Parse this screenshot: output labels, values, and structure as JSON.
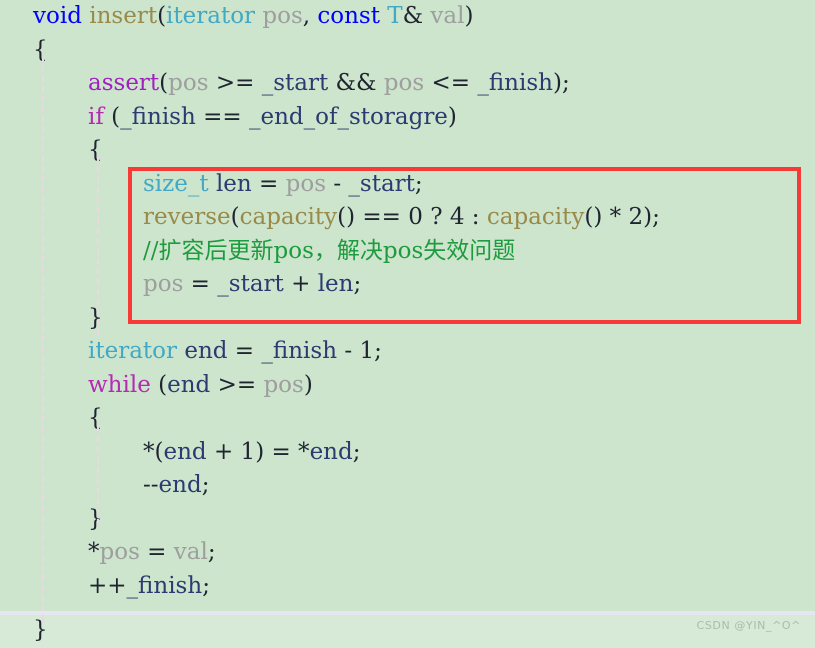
{
  "editor": {
    "background_color": "#cce5cc",
    "highlight_box_color": "#f73a35",
    "last_line_background": "#d7e9d7"
  },
  "watermark": {
    "text": "CSDN @YIN_^O^"
  },
  "code": {
    "language": "C++",
    "lines": [
      {
        "indent": 0,
        "tokens": [
          {
            "t": "void",
            "c": "k-blue"
          },
          {
            "t": " ",
            "c": "k-plain"
          },
          {
            "t": "insert",
            "c": "k-olive"
          },
          {
            "t": "(",
            "c": "k-plain"
          },
          {
            "t": "iterator",
            "c": "k-teal"
          },
          {
            "t": " ",
            "c": "k-plain"
          },
          {
            "t": "pos",
            "c": "k-gray"
          },
          {
            "t": ", ",
            "c": "k-plain"
          },
          {
            "t": "const",
            "c": "k-blue"
          },
          {
            "t": " ",
            "c": "k-plain"
          },
          {
            "t": "T",
            "c": "k-teal"
          },
          {
            "t": "& ",
            "c": "k-plain"
          },
          {
            "t": "val",
            "c": "k-gray"
          },
          {
            "t": ")",
            "c": "k-plain"
          }
        ]
      },
      {
        "indent": 0,
        "tokens": [
          {
            "t": "{",
            "c": "k-plain"
          }
        ]
      },
      {
        "indent": 1,
        "tokens": [
          {
            "t": "assert",
            "c": "k-purple"
          },
          {
            "t": "(",
            "c": "k-plain"
          },
          {
            "t": "pos",
            "c": "k-gray"
          },
          {
            "t": " >= ",
            "c": "k-plain"
          },
          {
            "t": "_start",
            "c": "k-navy"
          },
          {
            "t": " && ",
            "c": "k-plain"
          },
          {
            "t": "pos",
            "c": "k-gray"
          },
          {
            "t": " <= ",
            "c": "k-plain"
          },
          {
            "t": "_finish",
            "c": "k-navy"
          },
          {
            "t": ");",
            "c": "k-plain"
          }
        ]
      },
      {
        "indent": 1,
        "tokens": [
          {
            "t": "if",
            "c": "k-magenta"
          },
          {
            "t": " (",
            "c": "k-plain"
          },
          {
            "t": "_finish",
            "c": "k-navy"
          },
          {
            "t": " == ",
            "c": "k-plain"
          },
          {
            "t": "_end_of_storagre",
            "c": "k-navy"
          },
          {
            "t": ")",
            "c": "k-plain"
          }
        ]
      },
      {
        "indent": 1,
        "tokens": [
          {
            "t": "{",
            "c": "k-plain"
          }
        ]
      },
      {
        "indent": 2,
        "tokens": [
          {
            "t": "size_t",
            "c": "k-teal"
          },
          {
            "t": " ",
            "c": "k-plain"
          },
          {
            "t": "len",
            "c": "k-navy"
          },
          {
            "t": " = ",
            "c": "k-plain"
          },
          {
            "t": "pos",
            "c": "k-gray"
          },
          {
            "t": " - ",
            "c": "k-plain"
          },
          {
            "t": "_start",
            "c": "k-navy"
          },
          {
            "t": ";",
            "c": "k-plain"
          }
        ]
      },
      {
        "indent": 2,
        "tokens": [
          {
            "t": "reverse",
            "c": "k-olive"
          },
          {
            "t": "(",
            "c": "k-plain"
          },
          {
            "t": "capacity",
            "c": "k-olive"
          },
          {
            "t": "() == ",
            "c": "k-plain"
          },
          {
            "t": "0",
            "c": "k-num"
          },
          {
            "t": " ? ",
            "c": "k-plain"
          },
          {
            "t": "4",
            "c": "k-num"
          },
          {
            "t": " : ",
            "c": "k-plain"
          },
          {
            "t": "capacity",
            "c": "k-olive"
          },
          {
            "t": "() * ",
            "c": "k-plain"
          },
          {
            "t": "2",
            "c": "k-num"
          },
          {
            "t": ");",
            "c": "k-plain"
          }
        ]
      },
      {
        "indent": 2,
        "tokens": [
          {
            "t": "//扩容后更新pos，解决pos失效问题",
            "c": "k-green"
          }
        ]
      },
      {
        "indent": 2,
        "tokens": [
          {
            "t": "pos",
            "c": "k-gray"
          },
          {
            "t": " = ",
            "c": "k-plain"
          },
          {
            "t": "_start",
            "c": "k-navy"
          },
          {
            "t": " + ",
            "c": "k-plain"
          },
          {
            "t": "len",
            "c": "k-navy"
          },
          {
            "t": ";",
            "c": "k-plain"
          }
        ]
      },
      {
        "indent": 1,
        "tokens": [
          {
            "t": "}",
            "c": "k-plain"
          }
        ]
      },
      {
        "indent": 1,
        "tokens": [
          {
            "t": "iterator",
            "c": "k-teal"
          },
          {
            "t": " ",
            "c": "k-plain"
          },
          {
            "t": "end",
            "c": "k-navy"
          },
          {
            "t": " = ",
            "c": "k-plain"
          },
          {
            "t": "_finish",
            "c": "k-navy"
          },
          {
            "t": " - ",
            "c": "k-plain"
          },
          {
            "t": "1",
            "c": "k-num"
          },
          {
            "t": ";",
            "c": "k-plain"
          }
        ]
      },
      {
        "indent": 1,
        "tokens": [
          {
            "t": "while",
            "c": "k-magenta"
          },
          {
            "t": " (",
            "c": "k-plain"
          },
          {
            "t": "end",
            "c": "k-navy"
          },
          {
            "t": " >= ",
            "c": "k-plain"
          },
          {
            "t": "pos",
            "c": "k-gray"
          },
          {
            "t": ")",
            "c": "k-plain"
          }
        ]
      },
      {
        "indent": 1,
        "tokens": [
          {
            "t": "{",
            "c": "k-plain"
          }
        ]
      },
      {
        "indent": 2,
        "tokens": [
          {
            "t": "*(",
            "c": "k-plain"
          },
          {
            "t": "end",
            "c": "k-navy"
          },
          {
            "t": " + ",
            "c": "k-plain"
          },
          {
            "t": "1",
            "c": "k-num"
          },
          {
            "t": ") = *",
            "c": "k-plain"
          },
          {
            "t": "end",
            "c": "k-navy"
          },
          {
            "t": ";",
            "c": "k-plain"
          }
        ]
      },
      {
        "indent": 2,
        "tokens": [
          {
            "t": "--",
            "c": "k-plain"
          },
          {
            "t": "end",
            "c": "k-navy"
          },
          {
            "t": ";",
            "c": "k-plain"
          }
        ]
      },
      {
        "indent": 1,
        "tokens": [
          {
            "t": "}",
            "c": "k-plain"
          }
        ]
      },
      {
        "indent": 1,
        "tokens": [
          {
            "t": "*",
            "c": "k-plain"
          },
          {
            "t": "pos",
            "c": "k-gray"
          },
          {
            "t": " = ",
            "c": "k-plain"
          },
          {
            "t": "val",
            "c": "k-gray"
          },
          {
            "t": ";",
            "c": "k-plain"
          }
        ]
      },
      {
        "indent": 1,
        "tokens": [
          {
            "t": "++",
            "c": "k-plain"
          },
          {
            "t": "_finish",
            "c": "k-navy"
          },
          {
            "t": ";",
            "c": "k-plain"
          }
        ]
      }
    ],
    "last_line": {
      "indent": 0,
      "tokens": [
        {
          "t": "}",
          "c": "k-plain"
        }
      ]
    }
  }
}
